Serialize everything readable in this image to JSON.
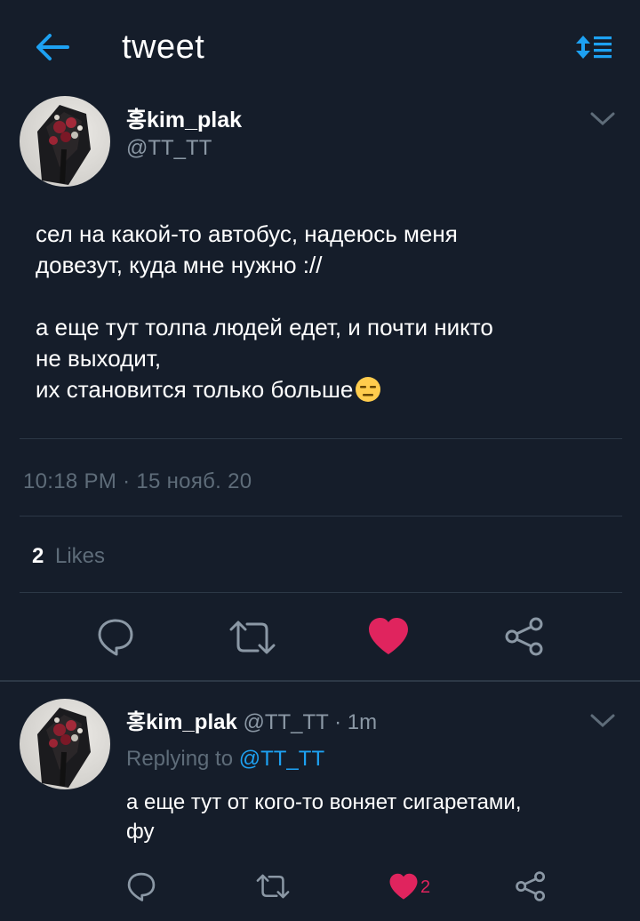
{
  "header": {
    "title": "tweet",
    "back_icon": "arrow-left-icon",
    "sort_icon": "sort-order-icon",
    "accent": "#1da1f2"
  },
  "tweet": {
    "display_name": "홍kim_plak",
    "handle": "@TT_TT",
    "text_lines": [
      "сел на какой-то автобус, надеюсь меня",
      "довезут, куда мне нужно ://",
      "",
      "а еще тут толпа людей едет, и почти никто",
      "не выходит,",
      "их становится только больше"
    ],
    "emoji": "expressionless-face-emoji",
    "timestamp": "10:18 PM · 15 нояб. 20",
    "likes_count": "2",
    "likes_label": "Likes",
    "liked": true,
    "like_color": "#e0245e"
  },
  "reply": {
    "display_name": "홍kim_plak",
    "handle_time": "@TT_TT · 1m",
    "replying_prefix": "Replying to",
    "replying_handle": "@TT_TT",
    "text_lines": [
      "а еще тут от кого-то воняет сигаретами,",
      "фу"
    ],
    "like_count": "2",
    "liked": true
  }
}
